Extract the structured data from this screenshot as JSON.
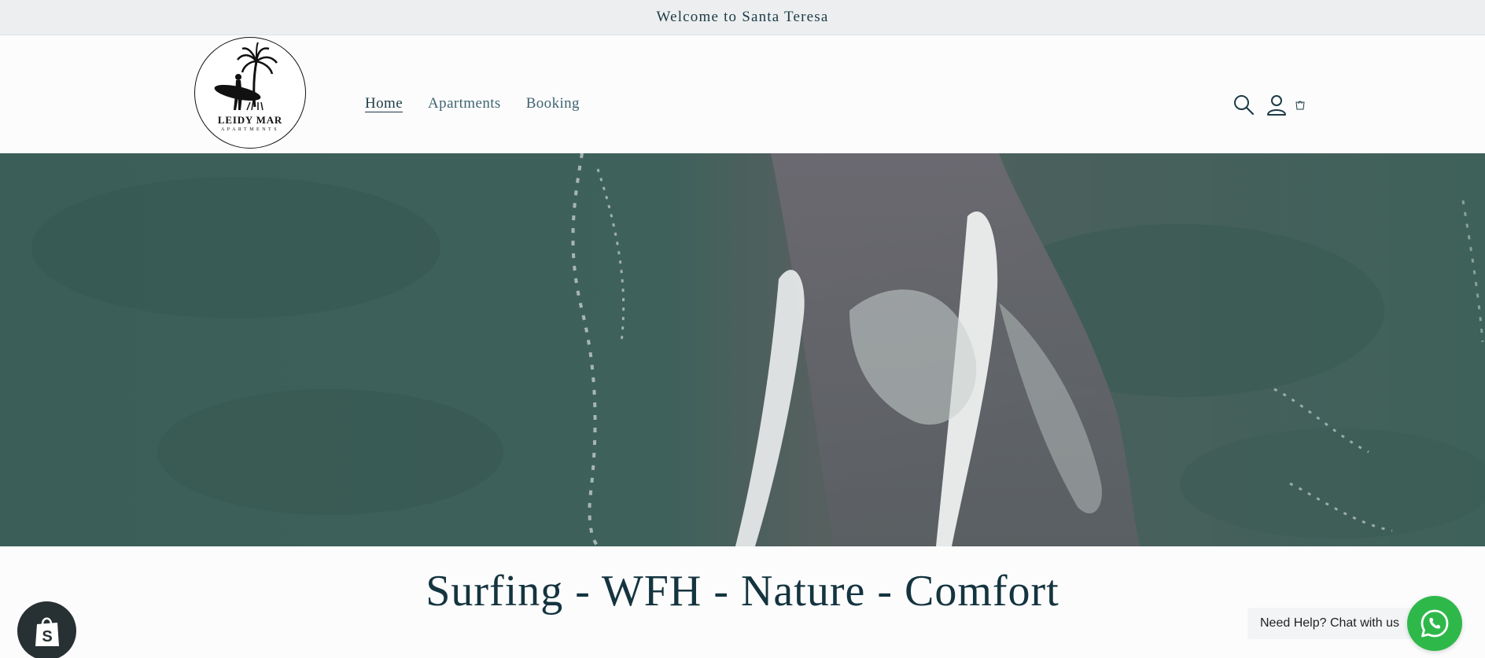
{
  "announcement": {
    "text": "Welcome to Santa Teresa"
  },
  "logo": {
    "title": "LEIDY MAR",
    "subtitle": "APARTMENTS"
  },
  "nav": {
    "items": [
      {
        "label": "Home",
        "active": true
      },
      {
        "label": "Apartments",
        "active": false
      },
      {
        "label": "Booking",
        "active": false
      }
    ]
  },
  "header_icons": [
    "search-icon",
    "account-icon",
    "cart-icon"
  ],
  "hero": {
    "image": "aerial-surf-wave"
  },
  "tagline": "Surfing - WFH - Nature - Comfort",
  "chat": {
    "label": "Need Help? Chat with us",
    "icon": "whatsapp-icon"
  },
  "badge": {
    "icon": "shopify-bag-icon"
  },
  "colors": {
    "text": "#1d3b45",
    "announcement_bg": "#eceef0",
    "whatsapp": "#2fb84a",
    "badge": "#273032"
  }
}
